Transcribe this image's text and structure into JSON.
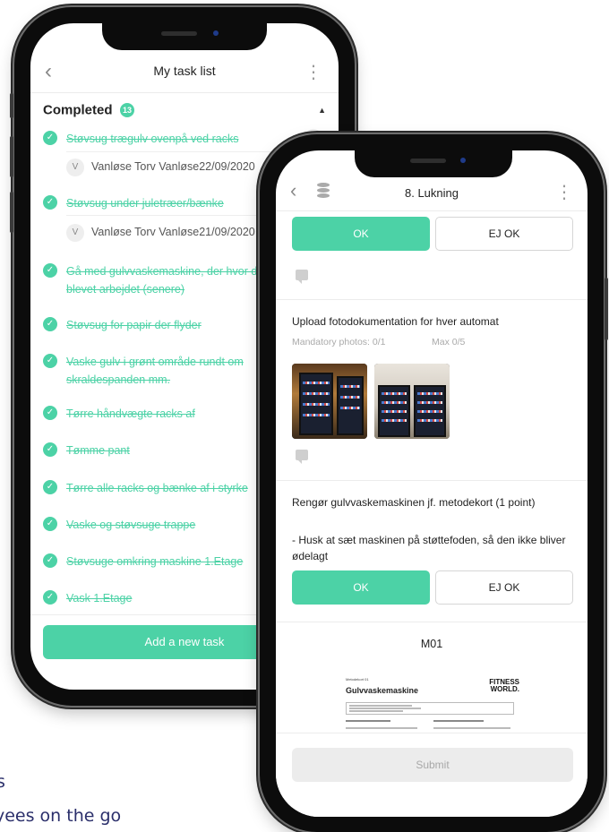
{
  "background": {
    "line1": "s",
    "line2": "yees on the go"
  },
  "phone1": {
    "header": {
      "title": "My task list",
      "back_icon": "chevron-left-icon",
      "more_icon": "more-vertical-icon"
    },
    "section": {
      "title": "Completed",
      "count": "13"
    },
    "tasks": [
      {
        "label": "Støvsug trægulv ovenpå ved racks",
        "avatar": "V",
        "sub": "Vanløse Torv Vanløse22/09/2020"
      },
      {
        "label": "Støvsug under juletræer/bænke",
        "sub": "Vanløse Torv Vanløse21/09/2020",
        "sub_avatar": "V"
      },
      {
        "label": "Gå med gulvvaskemaskine, der hvor der er blevet arbejdet (senere)"
      },
      {
        "label": "Støvsug for papir der flyder"
      },
      {
        "label": "Vaske gulv i grønt område rundt om skraldespanden mm."
      },
      {
        "label": "Tørre håndvægte racks af"
      },
      {
        "label": "Tømme pant"
      },
      {
        "label": "Tørre alle racks og bænke af i styrke"
      },
      {
        "label": "Vaske og støvsuge trappe"
      },
      {
        "label": "Støvsuge omkring maskine 1.Etage"
      },
      {
        "label": "Vask 1.Etage"
      }
    ],
    "add_button": "Add a new task"
  },
  "phone2": {
    "header": {
      "title": "8. Lukning"
    },
    "ok_label": "OK",
    "ejok_label": "EJ OK",
    "upload": {
      "question": "Upload fotodokumentation for hver automat",
      "mandatory": "Mandatory photos: 0/1",
      "max": "Max 0/5"
    },
    "clean": {
      "question": "Rengør gulvvaskemaskinen jf. metodekort (1 point)",
      "note": "- Husk at sæt maskinen på støttefoden, så den ikke bliver ødelagt"
    },
    "m01": "M01",
    "doc": {
      "label": "Metodekort 01",
      "title": "Gulvvaskemaskine",
      "brand_line1": "FITNESS",
      "brand_line2": "WORLD."
    },
    "submit": "Submit"
  }
}
